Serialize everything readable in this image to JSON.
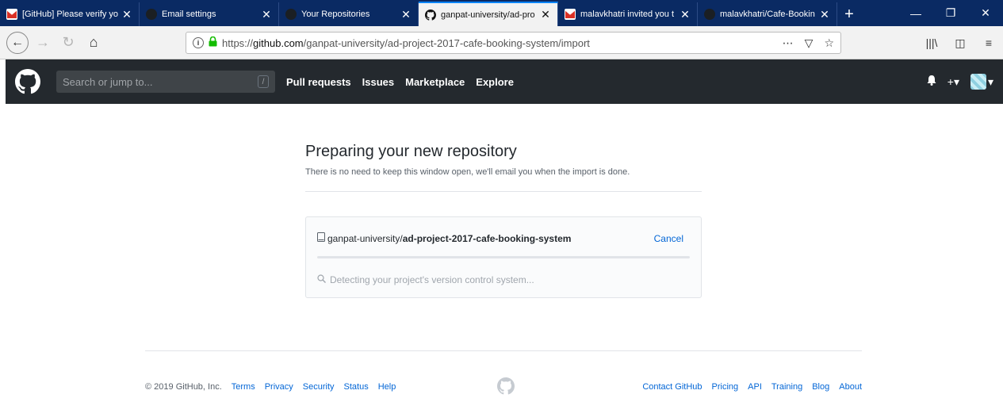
{
  "browser": {
    "tabs": [
      {
        "title": "[GitHub] Please verify yo",
        "icon": "gmail-icon",
        "active": false
      },
      {
        "title": "Email settings",
        "icon": "github-icon",
        "active": false
      },
      {
        "title": "Your Repositories",
        "icon": "github-icon",
        "active": false
      },
      {
        "title": "ganpat-university/ad-pro",
        "icon": "github-icon",
        "active": true
      },
      {
        "title": "malavkhatri invited you t",
        "icon": "gmail-icon",
        "active": false
      },
      {
        "title": "malavkhatri/Cafe-Bookin",
        "icon": "github-icon",
        "active": false
      }
    ],
    "close_glyph": "✕",
    "new_tab_glyph": "+",
    "url": {
      "prefix": "https://",
      "domain": "github.com",
      "path": "/ganpat-university/ad-project-2017-cafe-booking-system/import"
    },
    "colors": {
      "tabstrip": "#0a2a63",
      "active_tab_accent": "#0a84ff"
    }
  },
  "github_header": {
    "search_placeholder": "Search or jump to...",
    "search_hotkey": "/",
    "nav": [
      "Pull requests",
      "Issues",
      "Marketplace",
      "Explore"
    ],
    "colors": {
      "background": "#24292e"
    }
  },
  "main": {
    "title": "Preparing your new repository",
    "subtitle": "There is no need to keep this window open, we'll email you when the import is done.",
    "import": {
      "owner": "ganpat-university/",
      "repo": "ad-project-2017-cafe-booking-system",
      "cancel_label": "Cancel",
      "status": "Detecting your project's version control system..."
    }
  },
  "footer": {
    "copyright": "© 2019 GitHub, Inc.",
    "left_links": [
      "Terms",
      "Privacy",
      "Security",
      "Status",
      "Help"
    ],
    "right_links": [
      "Contact GitHub",
      "Pricing",
      "API",
      "Training",
      "Blog",
      "About"
    ],
    "colors": {
      "link": "#0366d6"
    }
  }
}
